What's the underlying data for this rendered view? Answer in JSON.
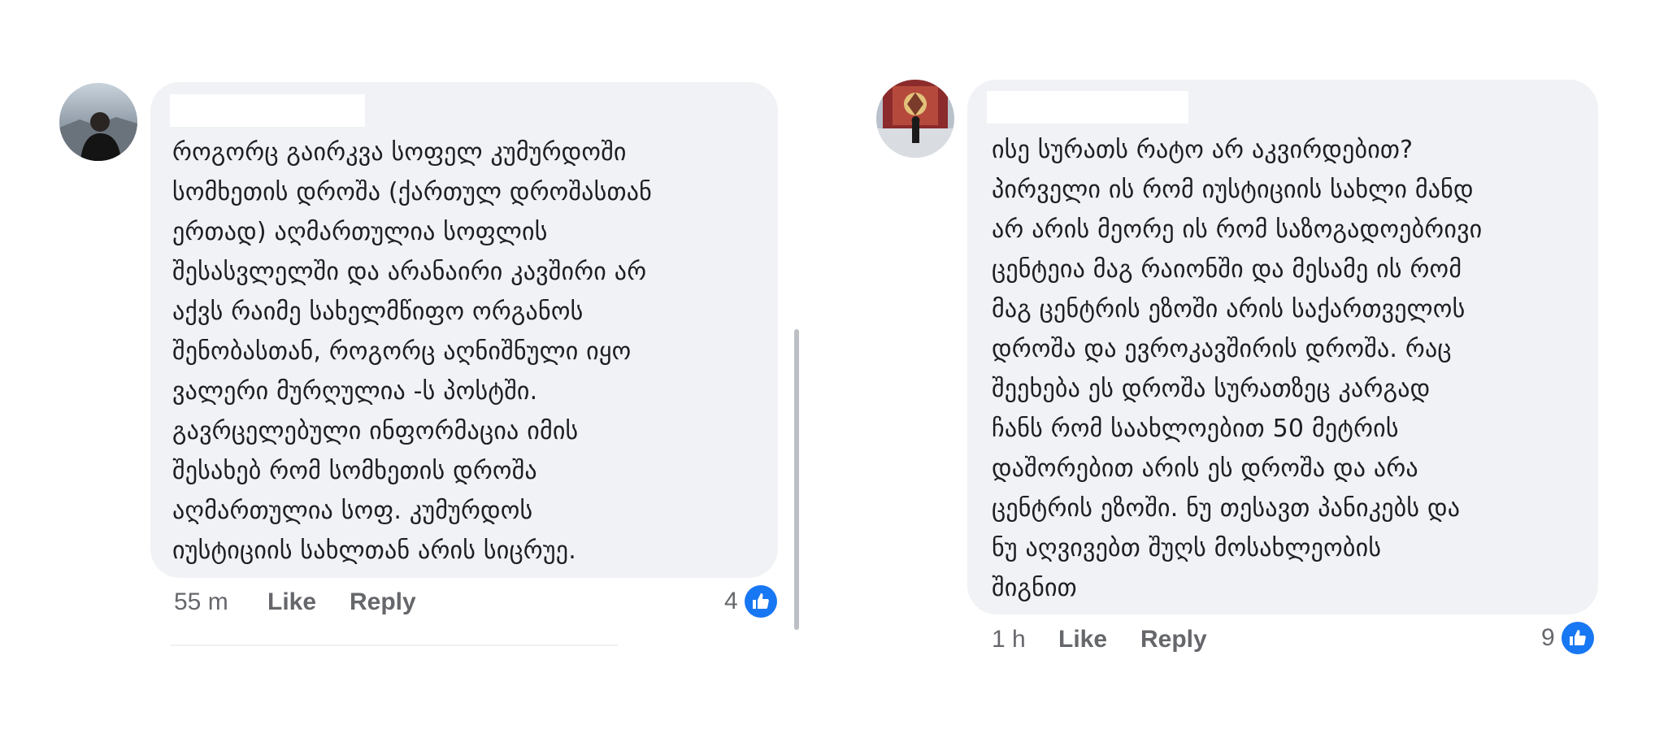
{
  "colors": {
    "bubble": "#f0f2f5",
    "text": "#1c1e21",
    "meta": "#65676b",
    "like_badge": "#1877f2"
  },
  "comments": [
    {
      "author": "",
      "lines": [
        "როგორც გაირკვა სოფელ კუმურდოში",
        "სომხეთის დროშა (ქართულ დროშასთან",
        "ერთად) აღმართულია სოფლის",
        "შესასვლელში და არანაირი კავშირი არ",
        "აქვს რაიმე სახელმწიფო ორგანოს",
        "შენობასთან, როგორც აღნიშნული იყო",
        "ვალერი მურღულია -ს პოსტში.",
        "გავრცელებული ინფორმაცია იმის",
        "შესახებ რომ სომხეთის დროშა",
        "აღმართულია სოფ. კუმურდოს",
        "იუსტიციის სახლთან არის სიცრუე."
      ],
      "time": "55 m",
      "like_label": "Like",
      "reply_label": "Reply",
      "reaction_count": "4",
      "reaction_icon": "thumbs-up-icon"
    },
    {
      "author": "",
      "lines": [
        "ისე სურათს რატო არ აკვირდებით?",
        "პირველი ის რომ იუსტიციის სახლი მანდ",
        "არ არის მეორე ის რომ საზოგადოებრივი",
        "ცენტეია მაგ რაიონში და მესამე ის რომ",
        "მაგ ცენტრის ეზოში არის საქართველოს",
        "დროშა და ევროკავშირის დროშა. რაც",
        "შეეხება ეს დროშა სურათზეც კარგად",
        "ჩანს რომ საახლოებით 50 მეტრის",
        "დაშორებით არის ეს დროშა და არა",
        "ცენტრის ეზოში. ნუ თესავთ პანიკებს და",
        "ნუ აღვივებთ შუღს მოსახლეობის",
        "შიგნით"
      ],
      "time": "1 h",
      "like_label": "Like",
      "reply_label": "Reply",
      "reaction_count": "9",
      "reaction_icon": "thumbs-up-icon"
    }
  ]
}
